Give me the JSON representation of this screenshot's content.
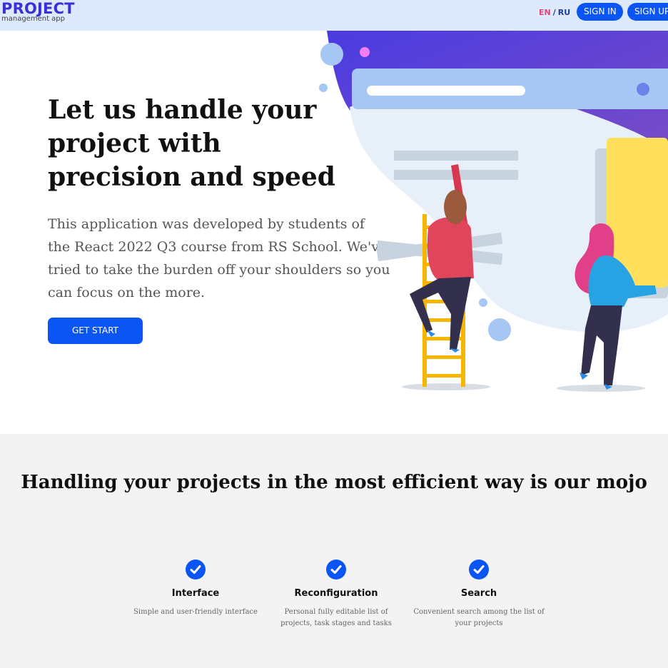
{
  "header": {
    "logo_title": "PROJECT",
    "logo_subtitle": "management app",
    "lang_en": "EN",
    "lang_separator": "/",
    "lang_ru": "RU",
    "sign_in": "SIGN IN",
    "sign_up": "SIGN UP"
  },
  "hero": {
    "title": "Let us handle your project with precision and speed",
    "description": "This application was developed by students of the React 2022 Q3 course from RS School. We've tried to take the burden off your shoulders so you can focus on the more.",
    "cta": "GET START"
  },
  "features": {
    "title": "Handling your projects in the most efficient way is our mojo",
    "items": [
      {
        "icon": "check-circle-icon",
        "name": "Interface",
        "description": "Simple and user-friendly interface"
      },
      {
        "icon": "check-circle-icon",
        "name": "Reconfiguration",
        "description": "Personal fully editable list of projects, task stages and tasks"
      },
      {
        "icon": "check-circle-icon",
        "name": "Search",
        "description": "Convenient search among the list of your projects"
      }
    ]
  },
  "colors": {
    "primary": "#0b55f5",
    "logo": "#3d2fd6",
    "header_bg": "#dde9fc",
    "lang_active": "#e0457b",
    "features_bg": "#f3f3f3"
  }
}
